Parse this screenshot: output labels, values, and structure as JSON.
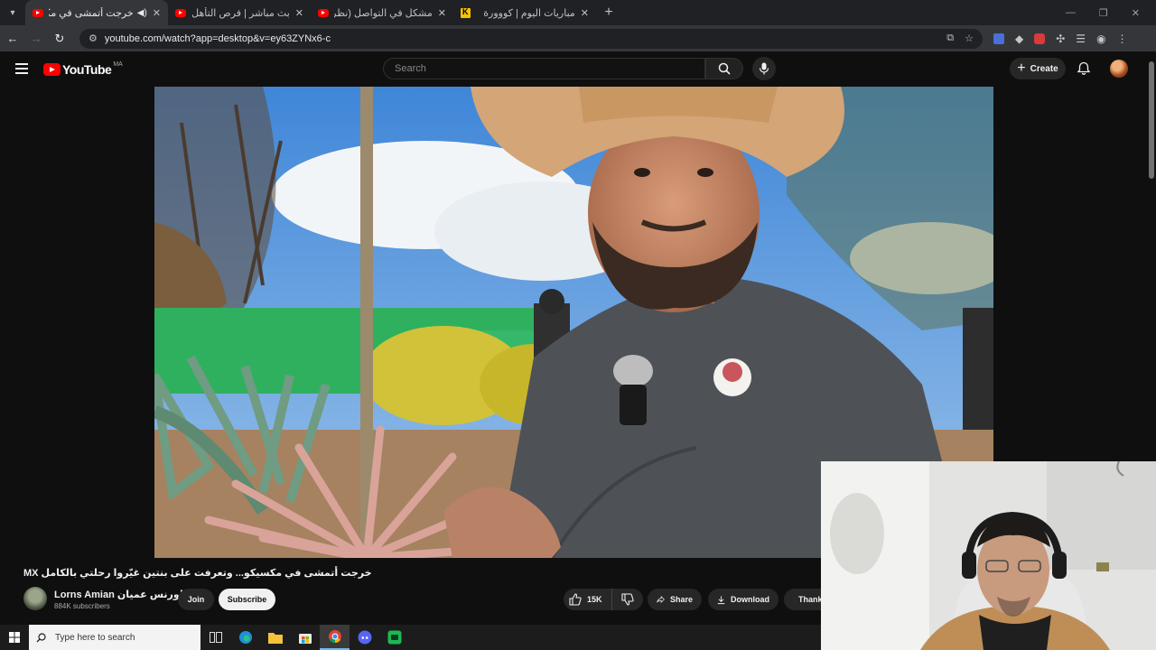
{
  "browser": {
    "tabs": [
      {
        "title": "خرجت أتمشى في مكسيكو...",
        "active": true,
        "audio": true
      },
      {
        "title": "بث مباشر | فرص التأهل للدور الثاني؟ (النشرة",
        "active": false
      },
      {
        "title": "مشكل في التواصل (نظرية النزاع",
        "active": false
      },
      {
        "title": "مباريات اليوم | كووورة",
        "active": false
      }
    ],
    "url": "youtube.com/watch?app=desktop&v=ey63ZYNx6-c"
  },
  "masthead": {
    "logo_text": "YouTube",
    "region": "MA",
    "search_placeholder": "Search",
    "create_label": "Create"
  },
  "video": {
    "title": "خرجت أتمشى في مكسيكو... وتعرفت على بنتين غيّروا رحلتي بالكامل MX",
    "channel_name": "Lorns Amian لورنس عميان",
    "subscribers": "884K subscribers",
    "join_label": "Join",
    "subscribe_label": "Subscribe",
    "likes": "15K",
    "share_label": "Share",
    "download_label": "Download",
    "thanks_label": "Thanks"
  },
  "taskbar": {
    "search_placeholder": "Type here to search"
  },
  "colors": {
    "background": "#0f0f0f",
    "brand_red": "#ff0000",
    "pill": "#272727"
  }
}
